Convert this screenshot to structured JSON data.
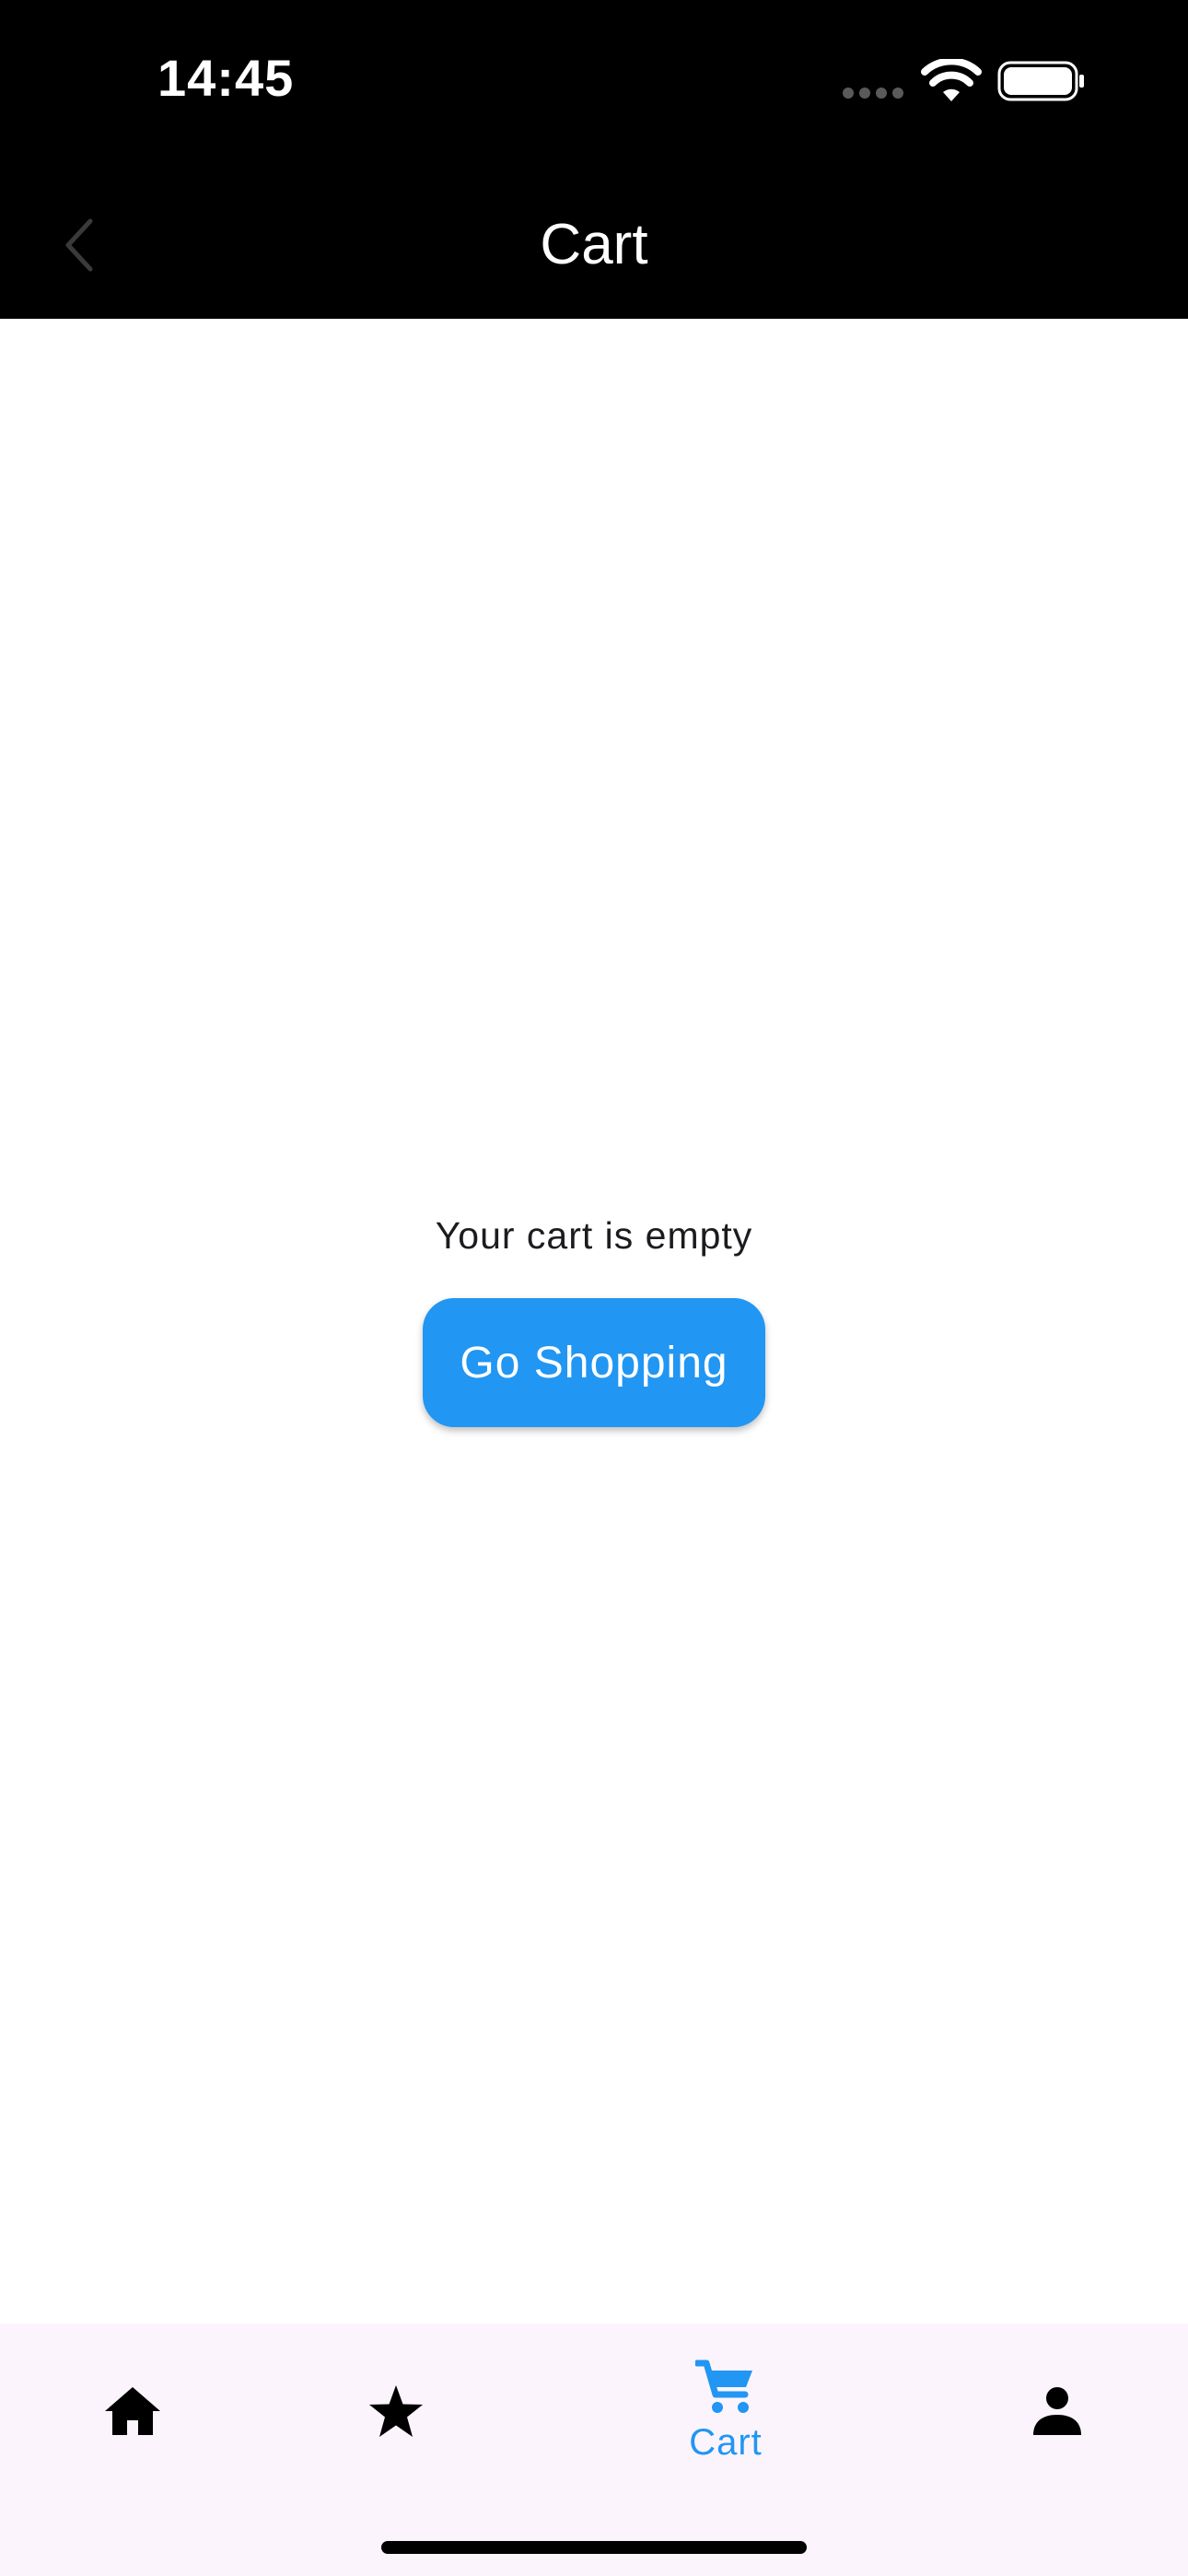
{
  "status_bar": {
    "time": "14:45",
    "icons": [
      "signal-dots-icon",
      "wifi-icon",
      "battery-icon"
    ]
  },
  "app_bar": {
    "title": "Cart",
    "back_icon": "chevron-left-icon"
  },
  "main": {
    "empty_message": "Your cart is empty",
    "go_shopping_label": "Go Shopping"
  },
  "bottom_nav": {
    "items": [
      {
        "icon": "home-icon",
        "label": "",
        "active": false
      },
      {
        "icon": "star-icon",
        "label": "",
        "active": false
      },
      {
        "icon": "cart-icon",
        "label": "Cart",
        "active": true
      },
      {
        "icon": "person-icon",
        "label": "",
        "active": false
      }
    ]
  },
  "colors": {
    "accent": "#2196f3",
    "bar_background": "#000000",
    "nav_background": "#fcf4fc",
    "text": "#1c1b1f"
  }
}
